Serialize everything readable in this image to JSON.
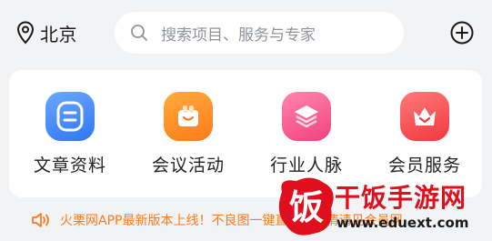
{
  "header": {
    "location_icon": "location-pin-icon",
    "city": "北京",
    "search": {
      "icon": "search-icon",
      "placeholder": "搜索项目、服务与专家"
    },
    "add_icon": "add-circle-icon"
  },
  "shortcuts": [
    {
      "label": "文章资料",
      "icon": "document-icon",
      "color": "#2f76f2"
    },
    {
      "label": "会议活动",
      "icon": "gift-box-icon",
      "color": "#ff7a1a"
    },
    {
      "label": "行业人脉",
      "icon": "layers-icon",
      "color": "#f2427e"
    },
    {
      "label": "会员服务",
      "icon": "crown-icon",
      "color": "#f0383e"
    }
  ],
  "notice": {
    "icon": "speaker-icon",
    "text": "火栗网APP最新版本上线！不良图一键直达，详情请见会员网",
    "color": "#ff7a1a"
  },
  "watermark": {
    "logo_text": "饭",
    "title": "干饭手游网",
    "url": "www.eduext.com"
  }
}
